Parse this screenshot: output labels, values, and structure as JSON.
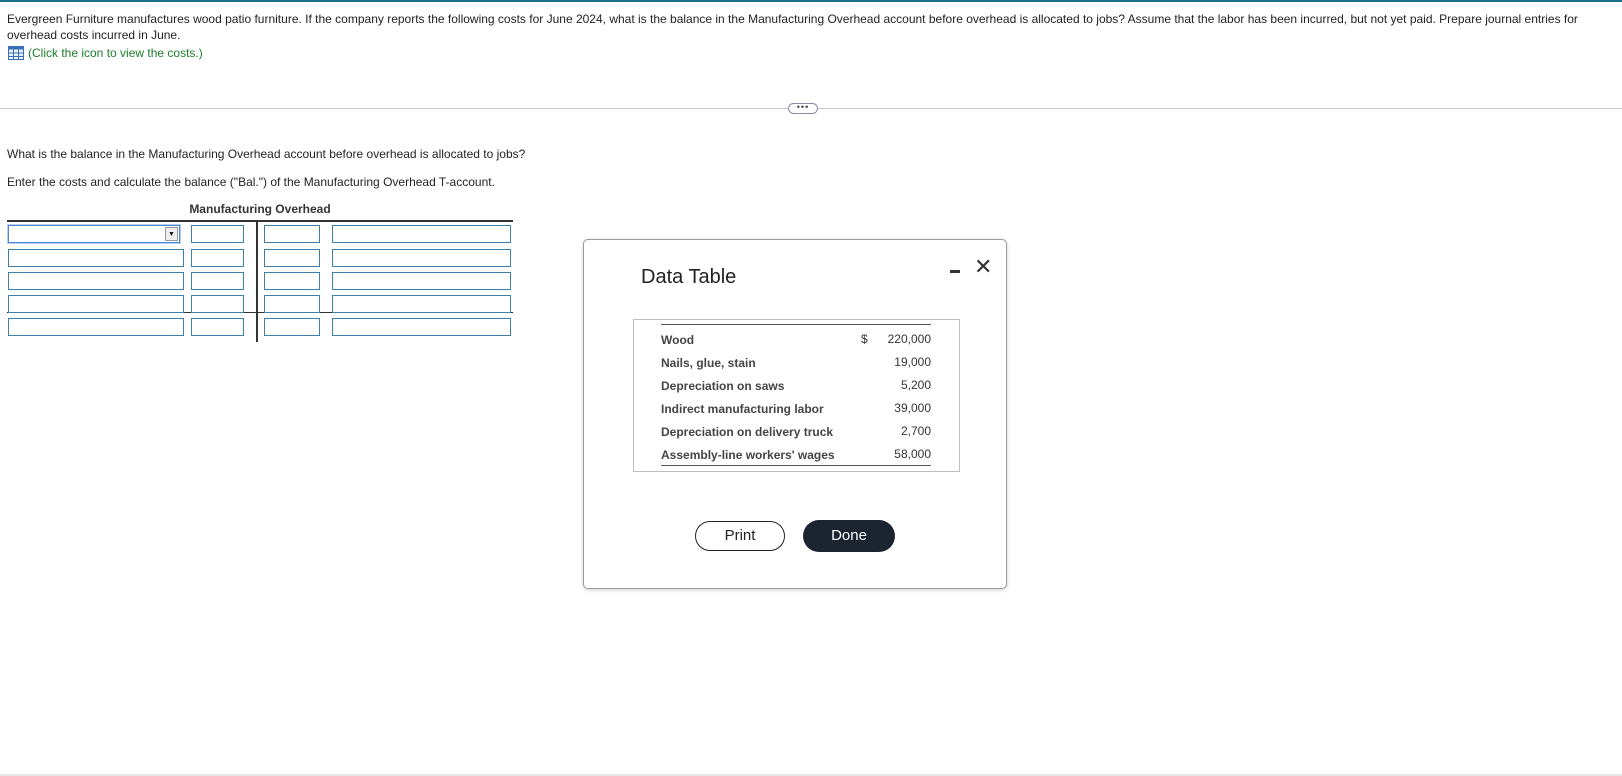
{
  "question": {
    "text": "Evergreen Furniture manufactures wood patio furniture. If the company reports the following costs for June 2024, what is the balance in the Manufacturing Overhead account before overhead is allocated to jobs? Assume that the labor has been incurred, but not yet paid. Prepare journal entries for overhead costs incurred in June.",
    "view_link": "(Click the icon to view the costs.)",
    "view_icon": "table-grid-icon"
  },
  "divider": {
    "handle_label": "•••"
  },
  "prompts": {
    "balance_question": "What is the balance in the Manufacturing Overhead account before overhead is allocated to jobs?",
    "instruction": "Enter the costs and calculate the balance (\"Bal.\") of the Manufacturing Overhead T-account."
  },
  "t_account": {
    "title": "Manufacturing Overhead",
    "select_arrow": "▼"
  },
  "modal": {
    "title": "Data Table",
    "minimize_icon": "minimize-icon",
    "close_label": "✕",
    "currency_symbol": "$",
    "rows": [
      {
        "label": "Wood",
        "value": "220,000"
      },
      {
        "label": "Nails, glue, stain",
        "value": "19,000"
      },
      {
        "label": "Depreciation on saws",
        "value": "5,200"
      },
      {
        "label": "Indirect manufacturing labor",
        "value": "39,000"
      },
      {
        "label": "Depreciation on delivery truck",
        "value": "2,700"
      },
      {
        "label": "Assembly-line workers' wages",
        "value": "58,000"
      }
    ],
    "print_label": "Print",
    "done_label": "Done"
  },
  "colors": {
    "accent": "#1d6f8c",
    "link_green": "#1a7f2a",
    "input_border": "#3d7fa6",
    "done_button": "#1c2430"
  }
}
